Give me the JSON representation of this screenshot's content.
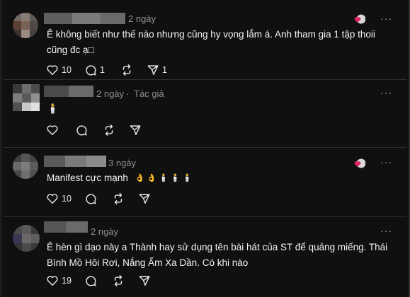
{
  "comments": [
    {
      "time": "2 ngày",
      "author_tag": "",
      "text_lines": [
        "Ê không biết như thế nào nhưng cũng hy vọng lắm á. Anh tham gia 1 tập thoii",
        "cũng đc ạ□"
      ],
      "likes": "10",
      "replies": "1",
      "reposts": "",
      "shares": "1"
    },
    {
      "time": "2 ngày",
      "author_tag": "Tác giả",
      "text_lines": [
        "🕯️"
      ],
      "likes": "",
      "replies": "",
      "reposts": "",
      "shares": ""
    },
    {
      "time": "3 ngày",
      "author_tag": "",
      "text_lines": [
        "Manifest cực mạnh"
      ],
      "emoji_tail": "👌 👌 🕯️ 🕯️ 🕯️",
      "likes": "10",
      "replies": "",
      "reposts": "",
      "shares": ""
    },
    {
      "time": "2 ngày",
      "author_tag": "",
      "text_lines": [
        "Ê hèn gì dạo này a Thành hay sử dụng tên bài hát của ST để quảng miếng. Thái",
        "Bình Mồ Hôi Rơi, Nắng Ấm Xa Dần. Có khi nào"
      ],
      "likes": "19",
      "replies": "",
      "reposts": "",
      "shares": ""
    }
  ],
  "colors": {
    "background": "#101010",
    "muted": "#8e8e8e",
    "text": "#f3f5f7",
    "heart_badge": "#e0245e"
  },
  "icons": {
    "like": "heart-icon",
    "reply": "comment-icon",
    "repost": "repost-icon",
    "share": "share-icon",
    "more": "more-options-icon"
  },
  "more_glyph": "···"
}
